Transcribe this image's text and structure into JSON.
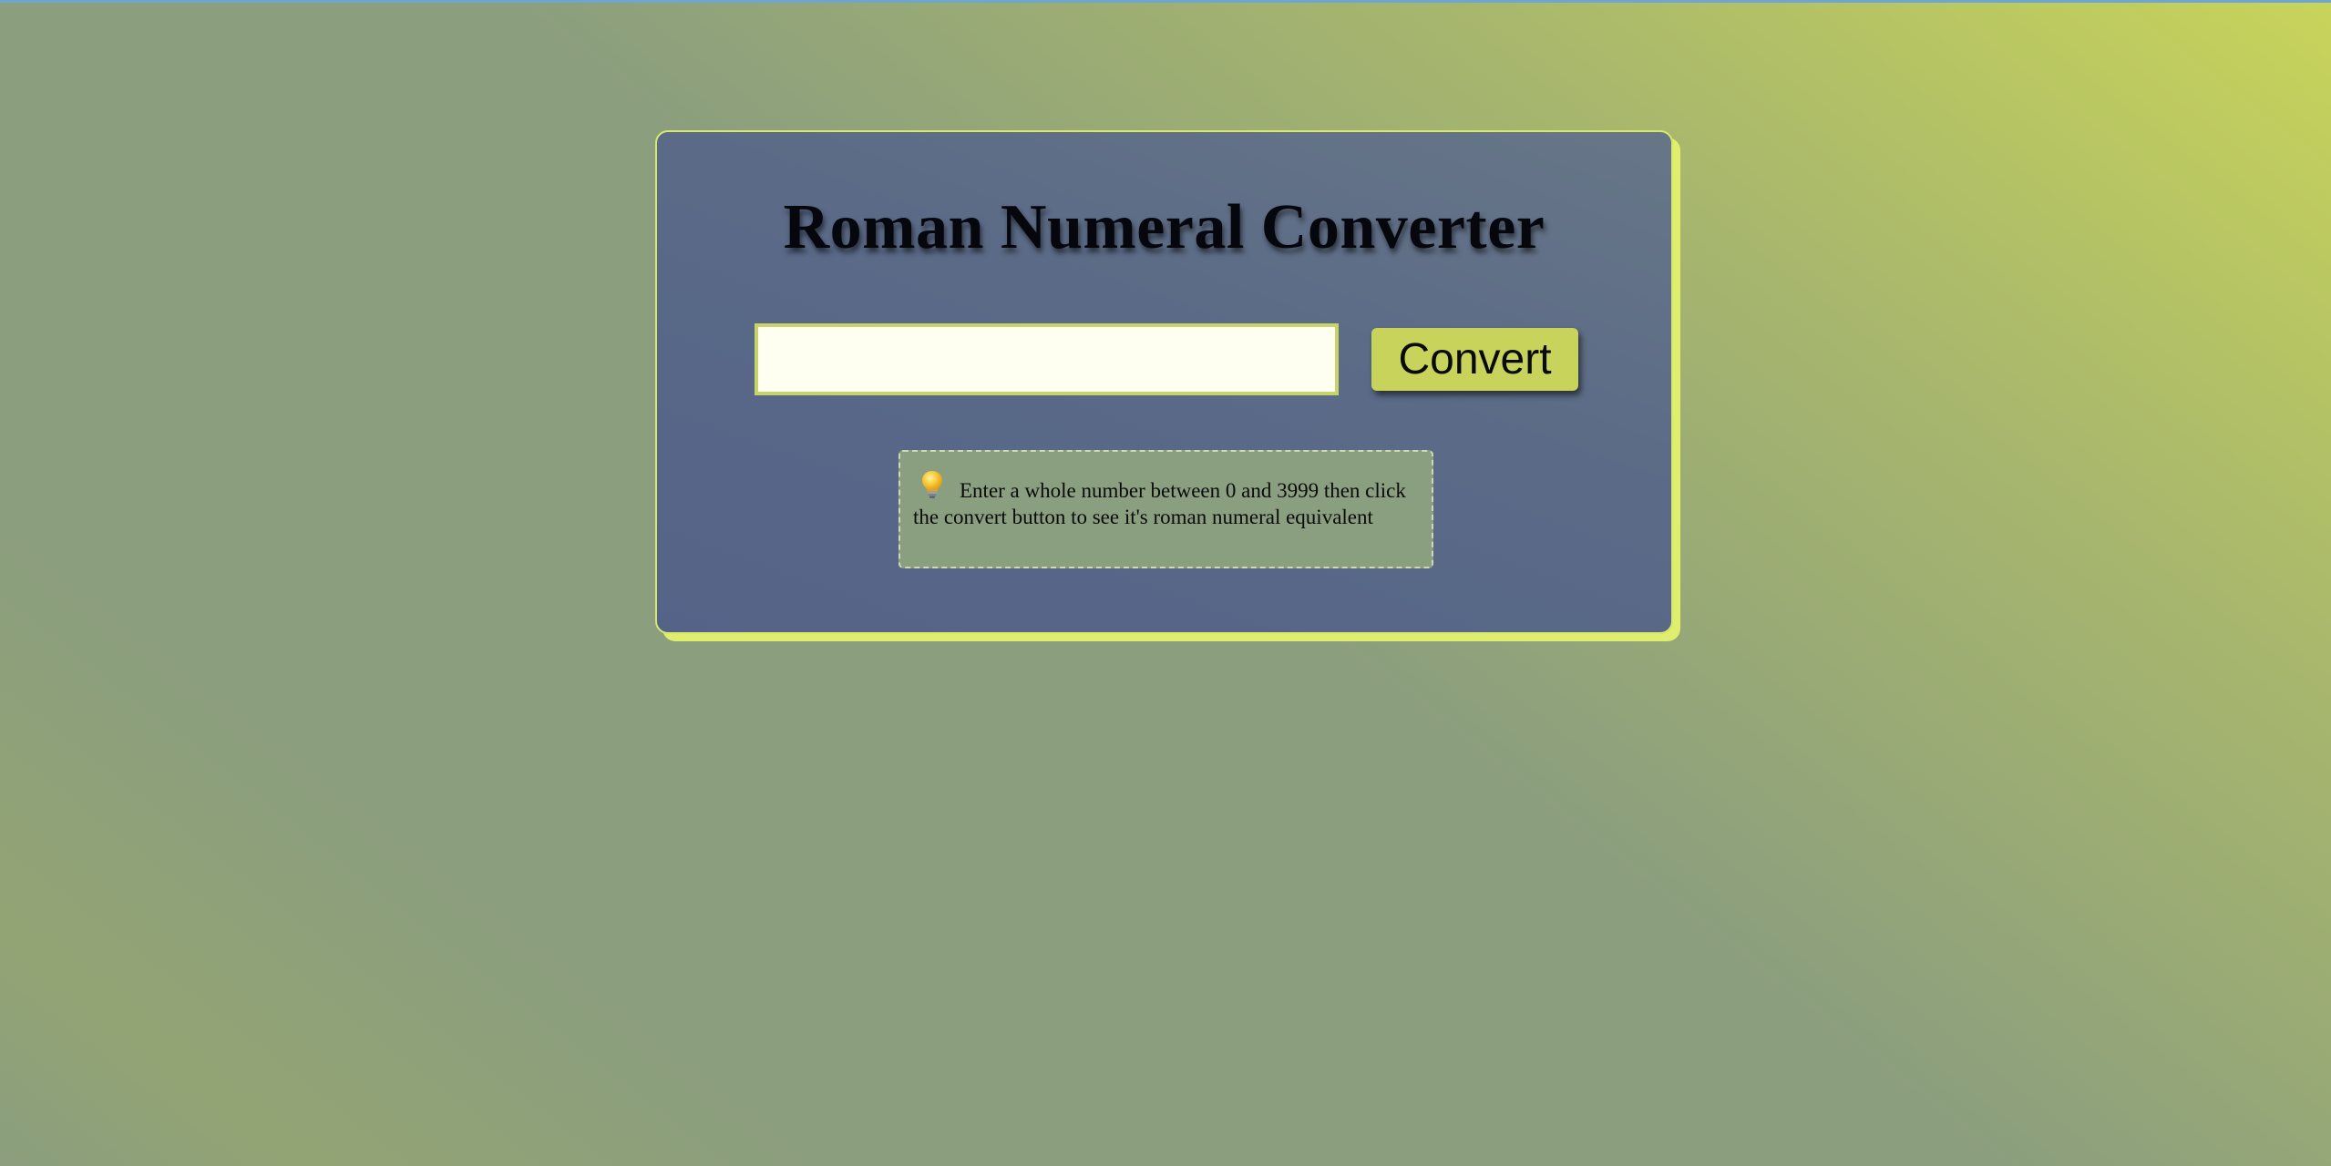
{
  "app": {
    "title": "Roman Numeral Converter"
  },
  "form": {
    "input_value": "",
    "input_placeholder": "",
    "convert_label": "Convert"
  },
  "hint": {
    "icon": "lightbulb-icon",
    "text": "Enter a whole number between 0 and 3999 then click the convert button to see it's roman numeral equivalent"
  },
  "colors": {
    "accent": "#c7d35b",
    "card_background": "#5a6a87",
    "card_border": "#d8e86a",
    "input_background": "#fefff0",
    "hint_background": "#8a9f7f"
  }
}
